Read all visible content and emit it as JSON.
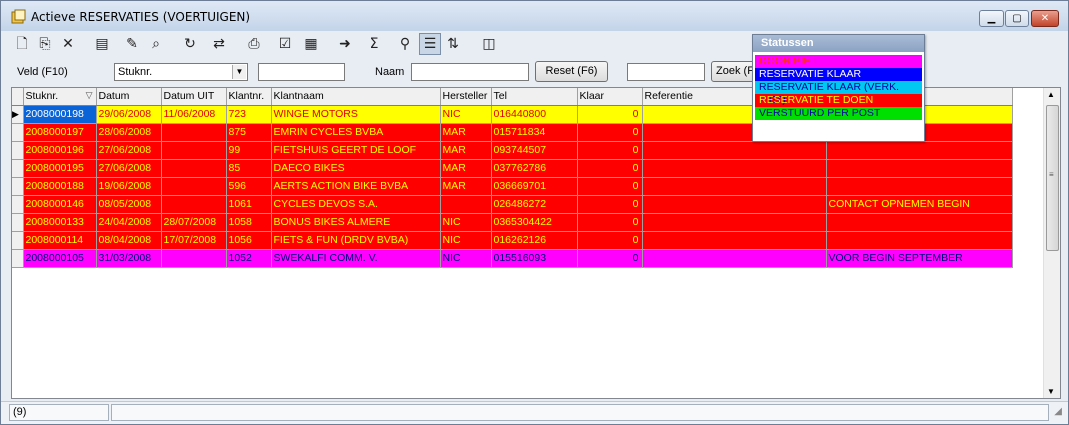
{
  "window": {
    "title": "Actieve RESERVATIES (VOERTUIGEN)"
  },
  "toolbar": {
    "buttons": [
      {
        "name": "new-icon",
        "glyph": "🗋"
      },
      {
        "name": "copy-icon",
        "glyph": "⎘"
      },
      {
        "name": "delete-icon",
        "glyph": "✕"
      },
      {
        "name": "properties-icon",
        "glyph": "▤"
      },
      {
        "name": "edit-icon",
        "glyph": "✎"
      },
      {
        "name": "find-icon",
        "glyph": "⌕"
      },
      {
        "name": "refresh-icon",
        "glyph": "↻"
      },
      {
        "name": "replace-icon",
        "glyph": "⇄"
      },
      {
        "name": "print-icon",
        "glyph": "⎙"
      },
      {
        "name": "checklist-icon",
        "glyph": "☑"
      },
      {
        "name": "report-icon",
        "glyph": "▦"
      },
      {
        "name": "export-icon",
        "glyph": "➜"
      },
      {
        "name": "sum-icon",
        "glyph": "Σ"
      },
      {
        "name": "zoom-icon",
        "glyph": "⚲"
      },
      {
        "name": "list-view-icon",
        "glyph": "☰"
      },
      {
        "name": "sort-icon",
        "glyph": "⇅"
      },
      {
        "name": "columns-icon",
        "glyph": "◫"
      }
    ]
  },
  "filter": {
    "field_label": "Veld (F10)",
    "field_value": "Stuknr.",
    "field_input": "",
    "name_label": "Naam",
    "name_input": "",
    "reset_label": "Reset (F6)",
    "search_input": "",
    "search_label": "Zoek (F"
  },
  "grid": {
    "columns": [
      "Stuknr.",
      "Datum",
      "Datum UIT",
      "Klantnr.",
      "Klantnaam",
      "Hersteller",
      "Tel",
      "Klaar",
      "Referentie",
      "",
      ""
    ],
    "sort_arrow": "▽",
    "rows": [
      {
        "stuknr": "2008000198",
        "datum": "29/06/2008",
        "datum_uit": "11/06/2008",
        "klantnr": "723",
        "klantnaam": "WINGE MOTORS",
        "hersteller": "NIC",
        "tel": "016440800",
        "klaar": "0",
        "referentie": "",
        "opmerking": "",
        "status": "klaar_piet"
      },
      {
        "stuknr": "2008000197",
        "datum": "28/06/2008",
        "datum_uit": "",
        "klantnr": "875",
        "klantnaam": "EMRIN CYCLES BVBA",
        "hersteller": "MAR",
        "tel": "015711834",
        "klaar": "0",
        "referentie": "",
        "opmerking": "",
        "status": "te_doen"
      },
      {
        "stuknr": "2008000196",
        "datum": "27/06/2008",
        "datum_uit": "",
        "klantnr": "99",
        "klantnaam": "FIETSHUIS GEERT DE LOOF",
        "hersteller": "MAR",
        "tel": "093744507",
        "klaar": "0",
        "referentie": "",
        "opmerking": "",
        "status": "te_doen"
      },
      {
        "stuknr": "2008000195",
        "datum": "27/06/2008",
        "datum_uit": "",
        "klantnr": "85",
        "klantnaam": "DAECO BIKES",
        "hersteller": "MAR",
        "tel": "037762786",
        "klaar": "0",
        "referentie": "",
        "opmerking": "",
        "status": "te_doen"
      },
      {
        "stuknr": "2008000188",
        "datum": "19/06/2008",
        "datum_uit": "",
        "klantnr": "596",
        "klantnaam": "AERTS ACTION BIKE BVBA",
        "hersteller": "MAR",
        "tel": "036669701",
        "klaar": "0",
        "referentie": "",
        "opmerking": "",
        "status": "te_doen"
      },
      {
        "stuknr": "2008000146",
        "datum": "08/05/2008",
        "datum_uit": "",
        "klantnr": "1061",
        "klantnaam": "CYCLES DEVOS S.A.",
        "hersteller": "",
        "tel": "026486272",
        "klaar": "0",
        "referentie": "",
        "opmerking": "CONTACT OPNEMEN BEGIN",
        "status": "te_doen"
      },
      {
        "stuknr": "2008000133",
        "datum": "24/04/2008",
        "datum_uit": "28/07/2008",
        "klantnr": "1058",
        "klantnaam": "BONUS BIKES ALMERE",
        "hersteller": "NIC",
        "tel": "0365304422",
        "klaar": "0",
        "referentie": "",
        "opmerking": "",
        "status": "te_doen"
      },
      {
        "stuknr": "2008000114",
        "datum": "08/04/2008",
        "datum_uit": "17/07/2008",
        "klantnr": "1056",
        "klantnaam": "FIETS & FUN (DRDV BVBA)",
        "hersteller": "NIC",
        "tel": "016262126",
        "klaar": "0",
        "referentie": "",
        "opmerking": "",
        "status": "te_doen"
      },
      {
        "stuknr": "2008000105",
        "datum": "31/03/2008",
        "datum_uit": "",
        "klantnr": "1052",
        "klantnaam": "SWEKALFI COMM. V.",
        "hersteller": "NIC",
        "tel": "015516093",
        "klaar": "0",
        "referentie": "",
        "opmerking": "VOOR BEGIN SEPTEMBER",
        "status": "door_piet"
      }
    ]
  },
  "status_colors": {
    "klaar_piet": {
      "bg": "#ffff00",
      "fg": "#e00000"
    },
    "te_doen": {
      "bg": "#ff0000",
      "fg": "#ffff00"
    },
    "door_piet": {
      "bg": "#ff00ff",
      "fg": "#000080"
    }
  },
  "legend": {
    "title": "Statussen",
    "items": [
      {
        "label": "DOOR PIET",
        "bg": "#ff00ff",
        "fg": "#ff3300"
      },
      {
        "label": "RESERVATIE KLAAR",
        "bg": "#0000ff",
        "fg": "#ffffff"
      },
      {
        "label": "RESERVATIE KLAAR (VERK. PIET)",
        "bg": "#00c8f0",
        "fg": "#0000a0"
      },
      {
        "label": "RESERVATIE TE DOEN",
        "bg": "#ff0000",
        "fg": "#ffff00"
      },
      {
        "label": "VERSTUURD PER POST",
        "bg": "#00e000",
        "fg": "#0000a0"
      }
    ]
  },
  "statusbar": {
    "count": "(9)"
  }
}
